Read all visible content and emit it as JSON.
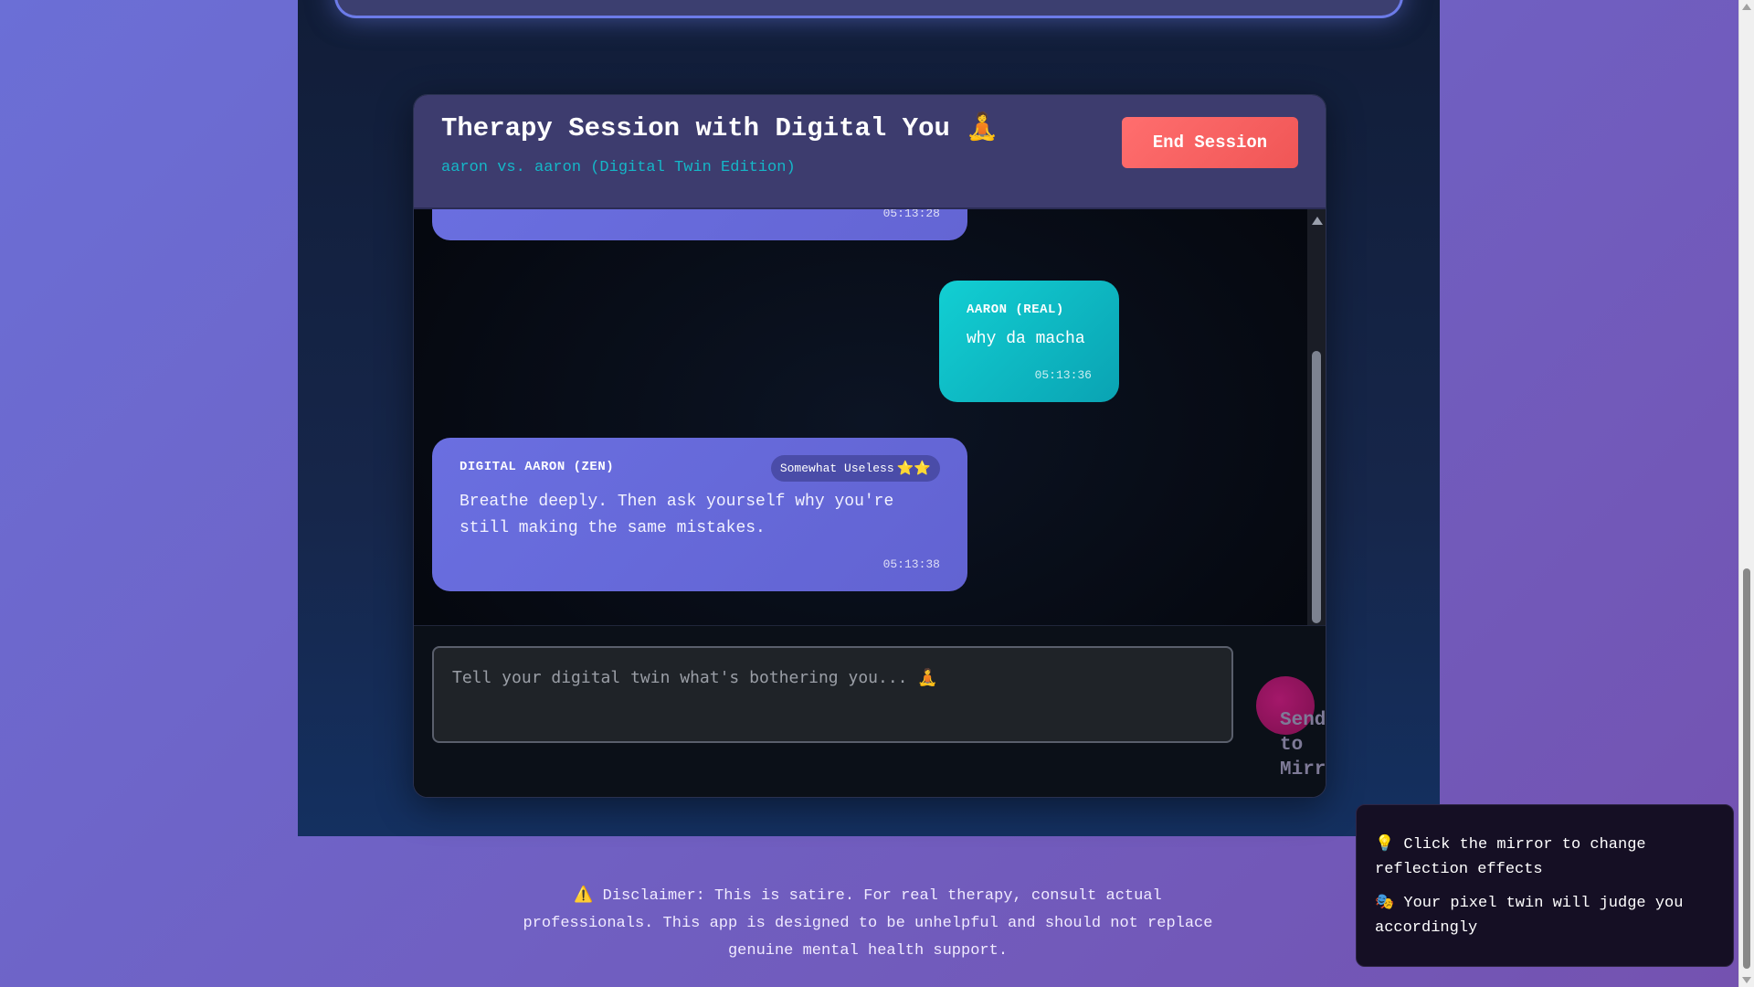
{
  "session": {
    "title": "Therapy Session with Digital You 🧘",
    "subtitle": "aaron vs. aaron (Digital Twin Edition)",
    "end_button": "End Session"
  },
  "messages": [
    {
      "time": "05:13:28"
    },
    {
      "sender": "AARON (REAL)",
      "text": "why da macha",
      "time": "05:13:36"
    },
    {
      "sender": "DIGITAL AARON (ZEN)",
      "rating_label": "Somewhat Useless",
      "rating_stars": 2,
      "stars_text": "⭐⭐",
      "text": "Breathe deeply. Then ask yourself why you're still making the same mistakes.",
      "time": "05:13:38"
    }
  ],
  "input": {
    "placeholder": "Tell your digital twin what's bothering you... 🧘",
    "send_label": "Send to Mirror"
  },
  "disclaimer": {
    "icon": "⚠️",
    "text": "Disclaimer: This is satire. For real therapy, consult actual professionals. This app is designed to be unhelpful and should not replace genuine mental health support."
  },
  "tips": [
    {
      "icon": "💡",
      "text": "Click the mirror to change reflection effects"
    },
    {
      "icon": "🎭",
      "text": "Your pixel twin will judge you accordingly"
    }
  ],
  "colors": {
    "accent_user": "#12cfd3",
    "accent_bot": "#6a6fe0",
    "end_button": "#ff6e6e",
    "subtitle": "#15b7c8"
  }
}
